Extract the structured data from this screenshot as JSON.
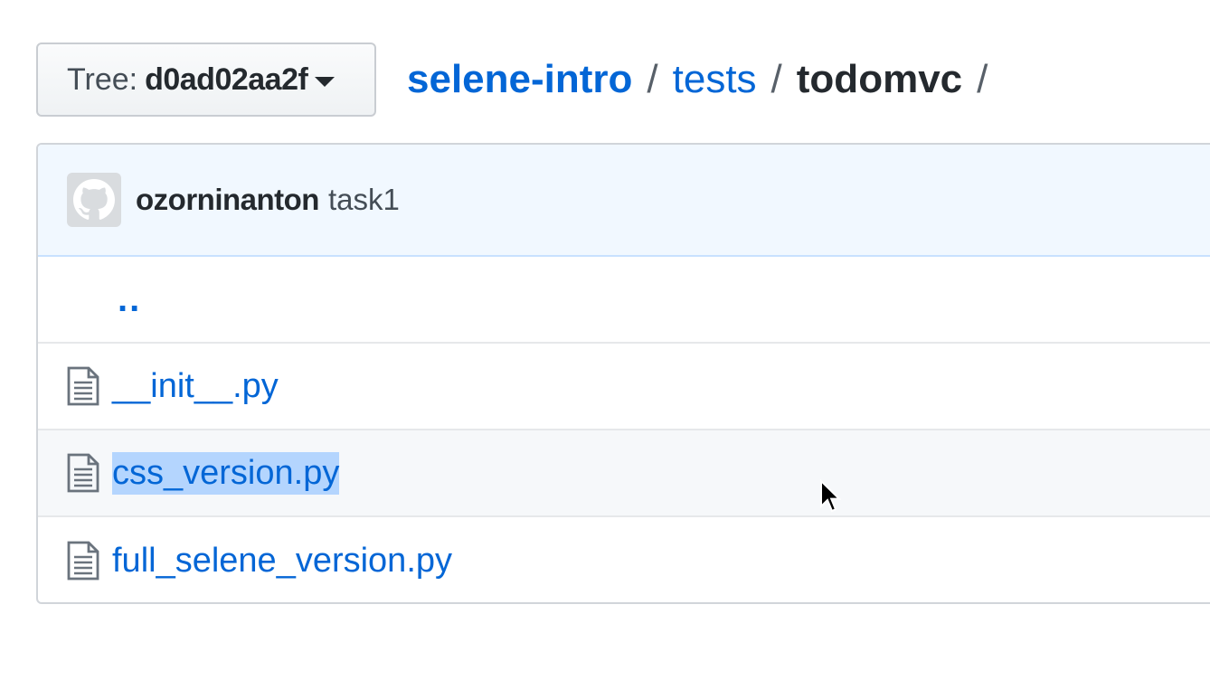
{
  "tree_button": {
    "label": "Tree:",
    "value": "d0ad02aa2f"
  },
  "breadcrumb": {
    "repo": "selene-intro",
    "folder": "tests",
    "current": "todomvc",
    "separator": "/"
  },
  "commit": {
    "author": "ozorninanton",
    "message": "task1"
  },
  "files": {
    "parent": "..",
    "items": [
      {
        "name": "__init__.py",
        "selected": false
      },
      {
        "name": "css_version.py",
        "selected": true
      },
      {
        "name": "full_selene_version.py",
        "selected": false
      }
    ]
  },
  "colors": {
    "link": "#0366d6",
    "commit_bar_bg": "#f1f8ff",
    "selection": "#b4d5fe"
  }
}
